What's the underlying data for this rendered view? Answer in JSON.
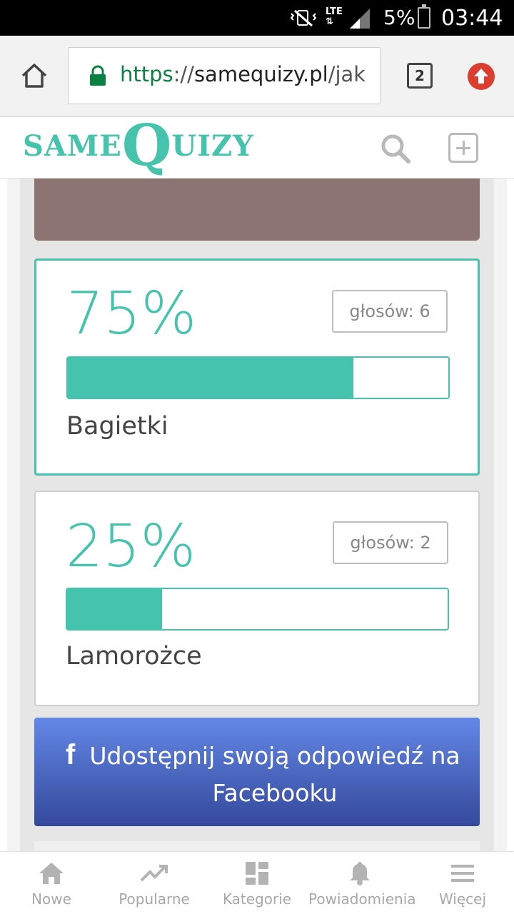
{
  "status_bar": {
    "battery": "5%",
    "time": "03:44",
    "network": "LTE"
  },
  "browser": {
    "url_scheme": "https",
    "url_sep": "://",
    "url_host": "samequizy.pl",
    "url_path": "/jak",
    "tab_count": "2"
  },
  "site": {
    "logo_same": "SAME",
    "logo_q": "Q",
    "logo_uizy": "UIZY"
  },
  "answers": [
    {
      "percent": "75%",
      "votes": "głosów: 6",
      "label": "Bagietki",
      "value": 0.75,
      "selected": true
    },
    {
      "percent": "25%",
      "votes": "głosów: 2",
      "label": "Lamorożce",
      "value": 0.25,
      "selected": false
    }
  ],
  "share": {
    "icon": "facebook-icon",
    "text": "Udostępnij swoją odpowiedź na Facebooku"
  },
  "bottom_nav": [
    {
      "label": "Nowe",
      "icon": "home-icon"
    },
    {
      "label": "Popularne",
      "icon": "trending-icon"
    },
    {
      "label": "Kategorie",
      "icon": "dashboard-icon"
    },
    {
      "label": "Powiadomienia",
      "icon": "bell-icon"
    },
    {
      "label": "Więcej",
      "icon": "menu-icon"
    }
  ],
  "colors": {
    "accent": "#45c3ac",
    "facebook_top": "#6387e6",
    "facebook_bottom": "#34499b",
    "update": "#db3d2f"
  }
}
